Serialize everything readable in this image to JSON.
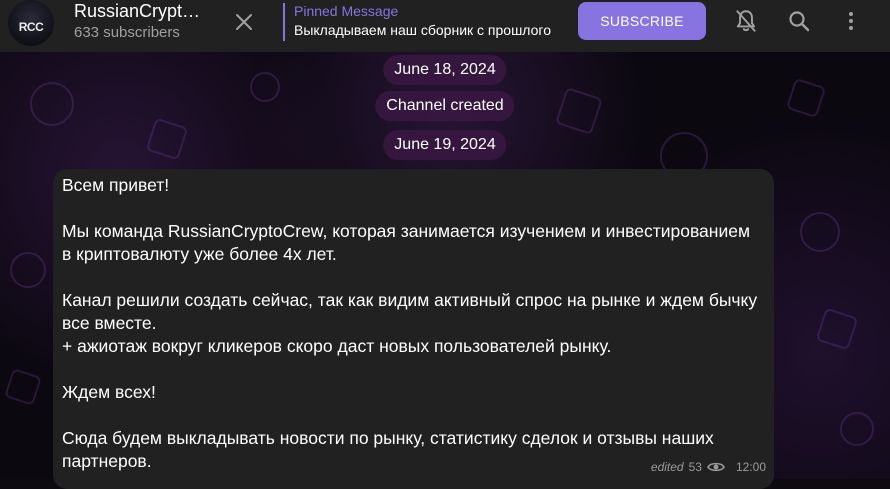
{
  "header": {
    "channel_name": "RussianCryptoCrew",
    "avatar_text": "RCC",
    "subscribers": "633 subscribers",
    "pinned_title": "Pinned Message",
    "pinned_text": "Выкладываем наш сборник с прошлого",
    "subscribe_label": "SUBSCRIBE",
    "icons": [
      "close-icon",
      "bell-off-icon",
      "search-icon",
      "more-vertical-icon"
    ]
  },
  "service": {
    "date1": "June 18, 2024",
    "created": "Channel created",
    "date2": "June 19, 2024"
  },
  "message": {
    "text": "Всем привет!\n\nМы команда RussianCryptoCrew, которая занимается изучением и инвестированием в криптовалюту уже более 4х лет.\n\nКанал решили создать сейчас, так как видим активный спрос на рынке и ждем бычку все вместе.\n+ ажиотаж вокруг кликеров скоро даст новых пользователей рынку.\n\nЖдем всех!\n\nСюда будем выкладывать новости по рынку, статистику сделок и отзывы наших партнеров.",
    "edited": "edited",
    "views": "53",
    "time": "12:00"
  },
  "colors": {
    "accent": "#8774e1",
    "header_bg": "#212121",
    "bubble_bg": "#212121",
    "pill_bg": "#3a1842"
  }
}
